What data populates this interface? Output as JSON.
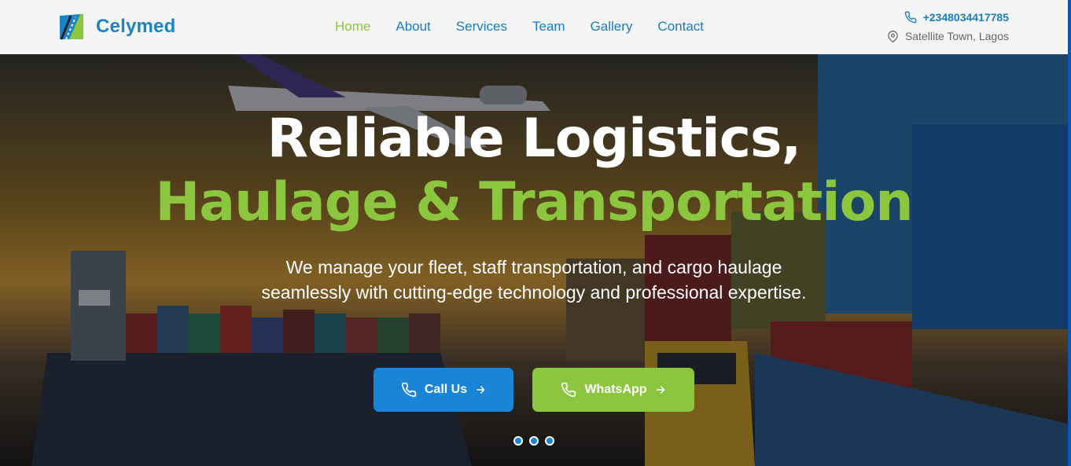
{
  "brand": {
    "name": "Celymed",
    "primary": "#1a85c6",
    "accent": "#8cc63f"
  },
  "nav": {
    "items": [
      {
        "label": "Home",
        "active": true
      },
      {
        "label": "About",
        "active": false
      },
      {
        "label": "Services",
        "active": false
      },
      {
        "label": "Team",
        "active": false
      },
      {
        "label": "Gallery",
        "active": false
      },
      {
        "label": "Contact",
        "active": false
      }
    ]
  },
  "contact": {
    "phone": "+2348034417785",
    "location": "Satellite Town, Lagos",
    "phone_icon": "phone-icon",
    "location_icon": "map-pin-icon"
  },
  "hero": {
    "headline_line1": "Reliable Logistics,",
    "headline_line2": "Haulage & Transportation",
    "subtext": "We manage your fleet, staff transportation, and cargo haulage seamlessly with cutting-edge technology and professional expertise.",
    "buttons": {
      "call": "Call Us",
      "whatsapp": "WhatsApp"
    },
    "slide_count": 3
  }
}
